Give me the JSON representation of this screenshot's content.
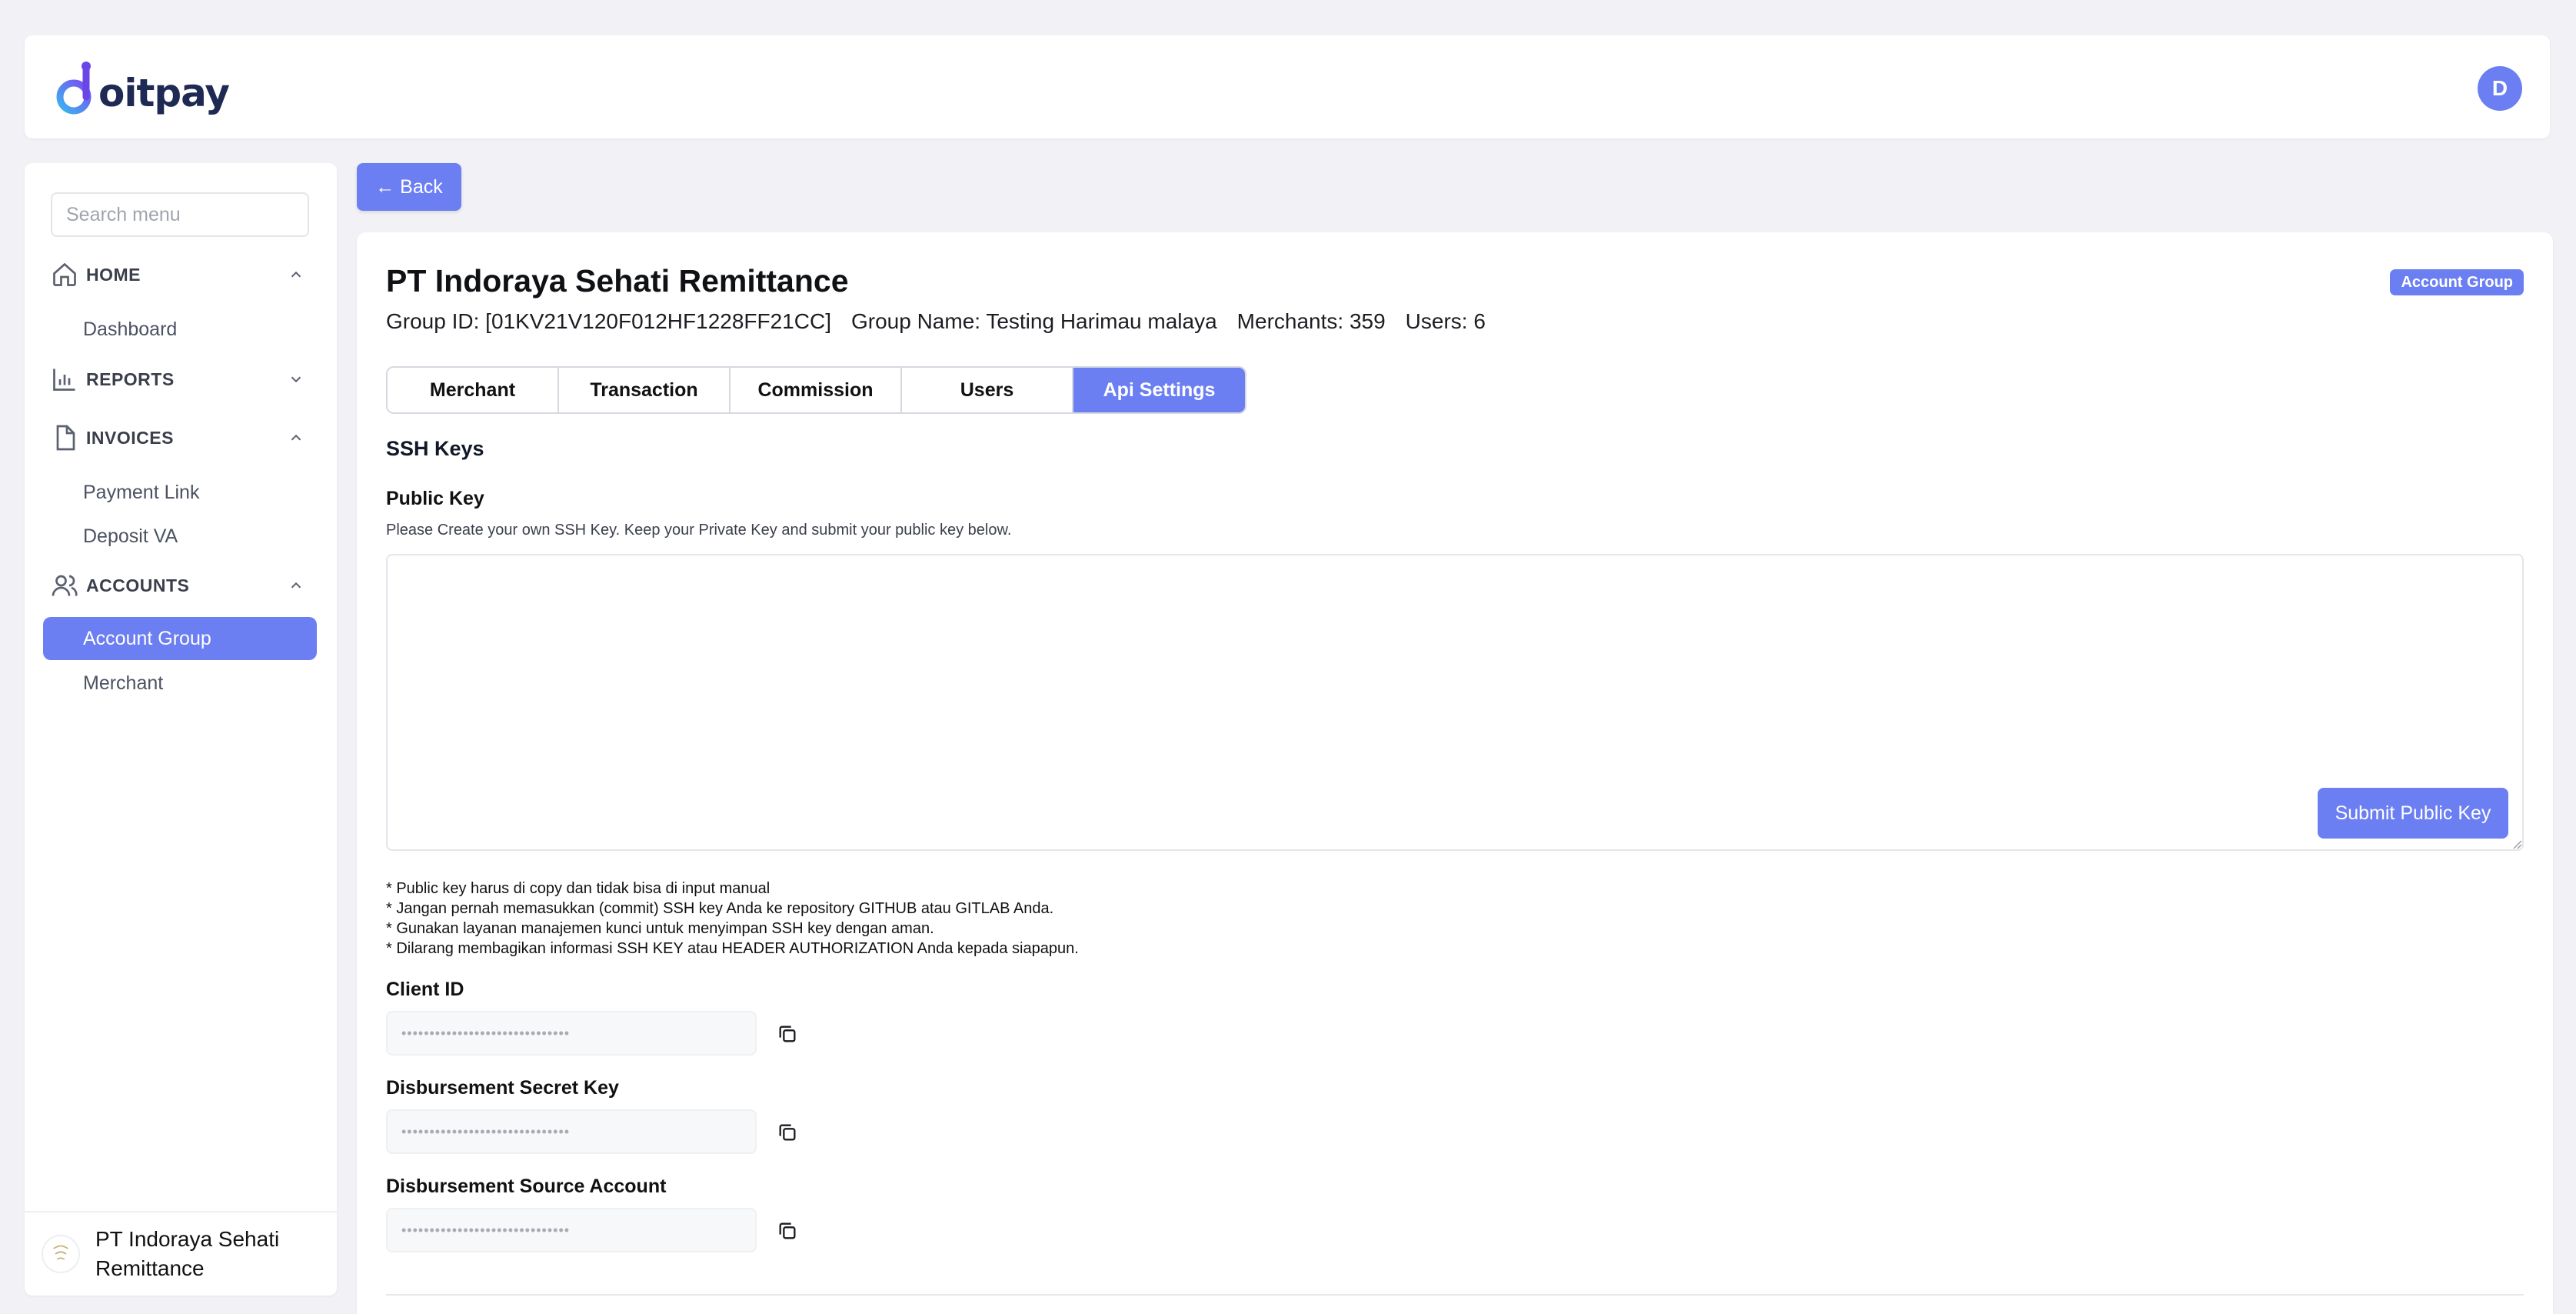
{
  "brand": {
    "logo_text": "oitpay",
    "logo_initial": "d"
  },
  "user": {
    "avatar_initial": "D"
  },
  "sidebar": {
    "search_placeholder": "Search menu",
    "sections": [
      {
        "label": "HOME",
        "icon": "home-icon",
        "chevron": "up",
        "items": [
          "Dashboard"
        ]
      },
      {
        "label": "REPORTS",
        "icon": "bar-chart-icon",
        "chevron": "down",
        "items": []
      },
      {
        "label": "INVOICES",
        "icon": "document-icon",
        "chevron": "up",
        "items": [
          "Payment Link",
          "Deposit VA"
        ]
      },
      {
        "label": "ACCOUNTS",
        "icon": "users-icon",
        "chevron": "up",
        "items": [
          "Account Group",
          "Merchant"
        ]
      }
    ],
    "active_item": "Account Group",
    "footer_name": "PT Indoraya Sehati Remittance"
  },
  "main": {
    "back_label": "← Back",
    "title": "PT Indoraya Sehati Remittance",
    "badge": "Account Group",
    "meta": {
      "group_id": "Group ID: [01KV21V120F012HF1228FF21CC]",
      "group_name": "Group Name: Testing Harimau malaya",
      "merchants": "Merchants: 359",
      "users": "Users: 6"
    },
    "tabs": [
      "Merchant",
      "Transaction",
      "Commission",
      "Users",
      "Api Settings"
    ],
    "active_tab": "Api Settings",
    "ssh_title": "SSH Keys",
    "public_key_label": "Public Key",
    "public_key_helper": "Please Create your own SSH Key. Keep your Private Key and submit your public key below.",
    "public_key_value": "",
    "submit_label": "Submit Public Key",
    "notes": [
      "* Public key harus di copy dan tidak bisa di input manual",
      "* Jangan pernah memasukkan (commit) SSH key Anda ke repository GITHUB atau GITLAB Anda.",
      "* Gunakan layanan manajemen kunci untuk menyimpan SSH key dengan aman.",
      "* Dilarang membagikan informasi SSH KEY atau HEADER AUTHORIZATION Anda kepada siapapun."
    ],
    "client_id_label": "Client ID",
    "client_id_value": "••••••••••••••••••••••••••••••",
    "secret_key_label": "Disbursement Secret Key",
    "secret_key_value": "••••••••••••••••••••••••••••••",
    "source_account_label": "Disbursement Source Account",
    "source_account_value": "••••••••••••••••••••••••••••••"
  },
  "colors": {
    "accent": "#6b7ff3",
    "background": "#f2f2f6",
    "brand_dark": "#1e2a54"
  }
}
